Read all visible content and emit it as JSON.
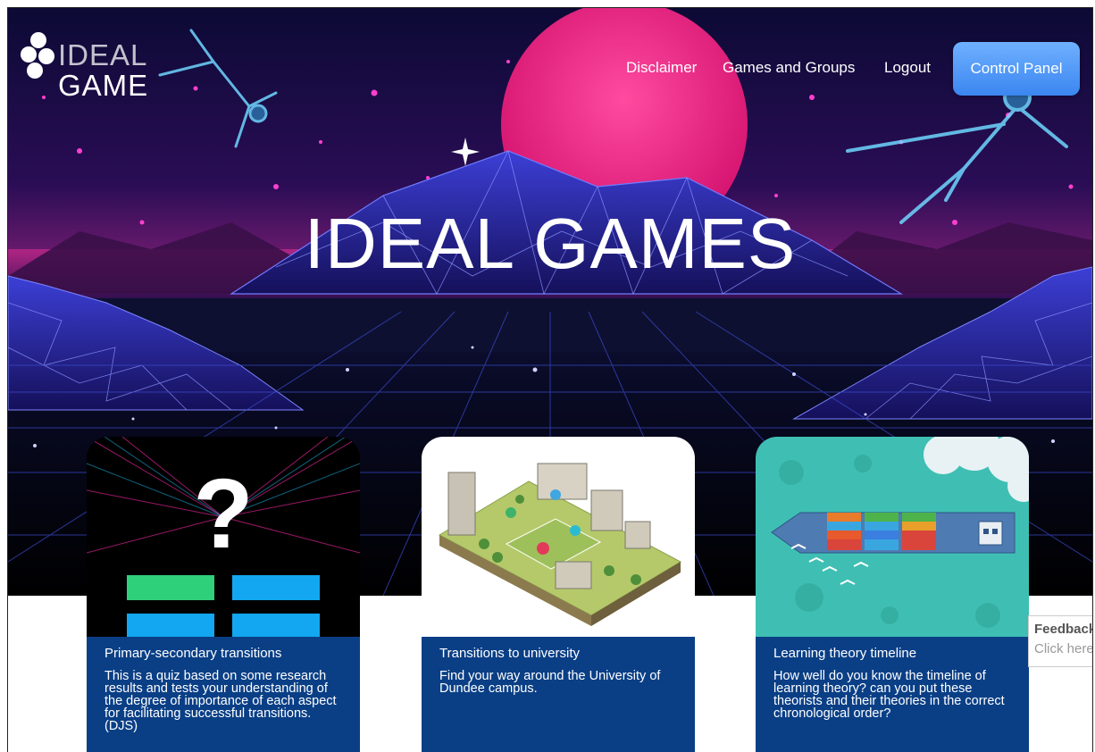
{
  "brand": {
    "logo_top": "IDEAL",
    "logo_bottom": "GAME"
  },
  "nav": {
    "links": [
      "Disclaimer",
      "Games and Groups",
      "Logout"
    ],
    "control_panel": "Control Panel"
  },
  "hero": {
    "title": "IDEAL GAMES"
  },
  "cards": [
    {
      "title": "Primary-secondary transitions",
      "description": "This is a quiz based on some research results and tests your understanding of the degree of importance of each aspect for facilitating successful transitions. (DJS)"
    },
    {
      "title": "Transitions to university",
      "description": "Find your way around the University of Dundee campus."
    },
    {
      "title": "Learning theory timeline",
      "description": "How well do you know the timeline of learning theory? can you put these theorists and their theories in the correct chronological order?"
    }
  ],
  "feedback": {
    "title": "Feedback",
    "subtitle": "Click here"
  },
  "colors": {
    "card_body": "#0a3f86",
    "button": "#4a93f5"
  }
}
